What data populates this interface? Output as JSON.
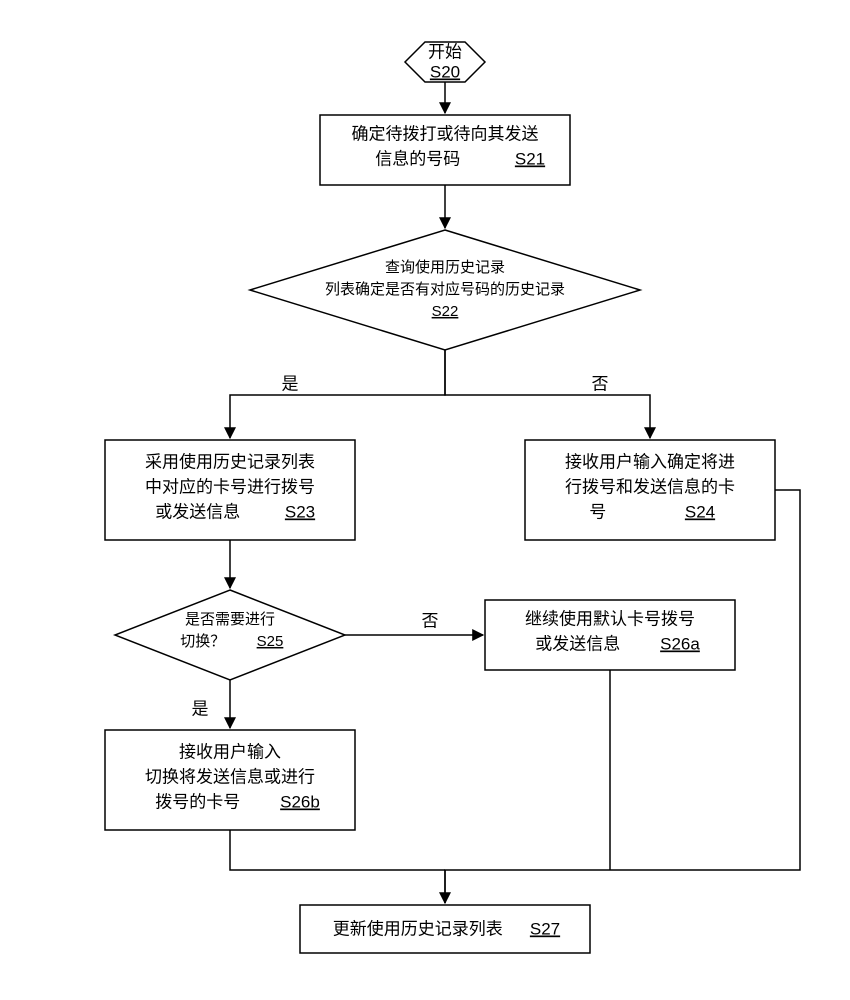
{
  "nodes": {
    "start": {
      "line1": "开始",
      "id": "S20"
    },
    "s21": {
      "line1": "确定待拨打或待向其发送",
      "line2": "信息的号码",
      "id": "S21"
    },
    "s22": {
      "line1": "查询使用历史记录",
      "line2": "列表确定是否有对应号码的历史记录",
      "id": "S22"
    },
    "s23": {
      "line1": "采用使用历史记录列表",
      "line2": "中对应的卡号进行拨号",
      "line3": "或发送信息",
      "id": "S23"
    },
    "s24": {
      "line1": "接收用户输入确定将进",
      "line2": "行拨号和发送信息的卡",
      "line3": "号",
      "id": "S24"
    },
    "s25": {
      "line1": "是否需要进行",
      "line2": "切换？",
      "id": "S25"
    },
    "s26a": {
      "line1": "继续使用默认卡号拨号",
      "line2": "或发送信息",
      "id": "S26a"
    },
    "s26b": {
      "line1": "接收用户输入",
      "line2": "切换将发送信息或进行",
      "line3": "拨号的卡号",
      "id": "S26b"
    },
    "s27": {
      "line1": "更新使用历史记录列表",
      "id": "S27"
    }
  },
  "edges": {
    "s22_yes": "是",
    "s22_no": "否",
    "s25_yes": "是",
    "s25_no": "否"
  }
}
